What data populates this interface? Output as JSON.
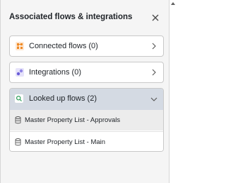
{
  "panel": {
    "title": "Associated flows & integrations"
  },
  "sections": {
    "connected": {
      "label": "Connected flows (0)"
    },
    "integrations": {
      "label": "Integrations (0)"
    },
    "looked_up": {
      "label": "Looked up flows (2)",
      "items": [
        {
          "label": "Master Property List - Approvals"
        },
        {
          "label": "Master Property List - Main"
        }
      ]
    }
  },
  "colors": {
    "connected_icon": "#f08a24",
    "integrations_icon": "#6a5cd8",
    "looked_up_icon": "#2e9e5a",
    "expanded_header_bg": "#d4dae3"
  },
  "icons": {
    "close": "close-icon",
    "connected": "connected-flows-icon",
    "integrations": "integrations-icon",
    "looked_up": "search-icon",
    "flow_item": "database-icon"
  }
}
